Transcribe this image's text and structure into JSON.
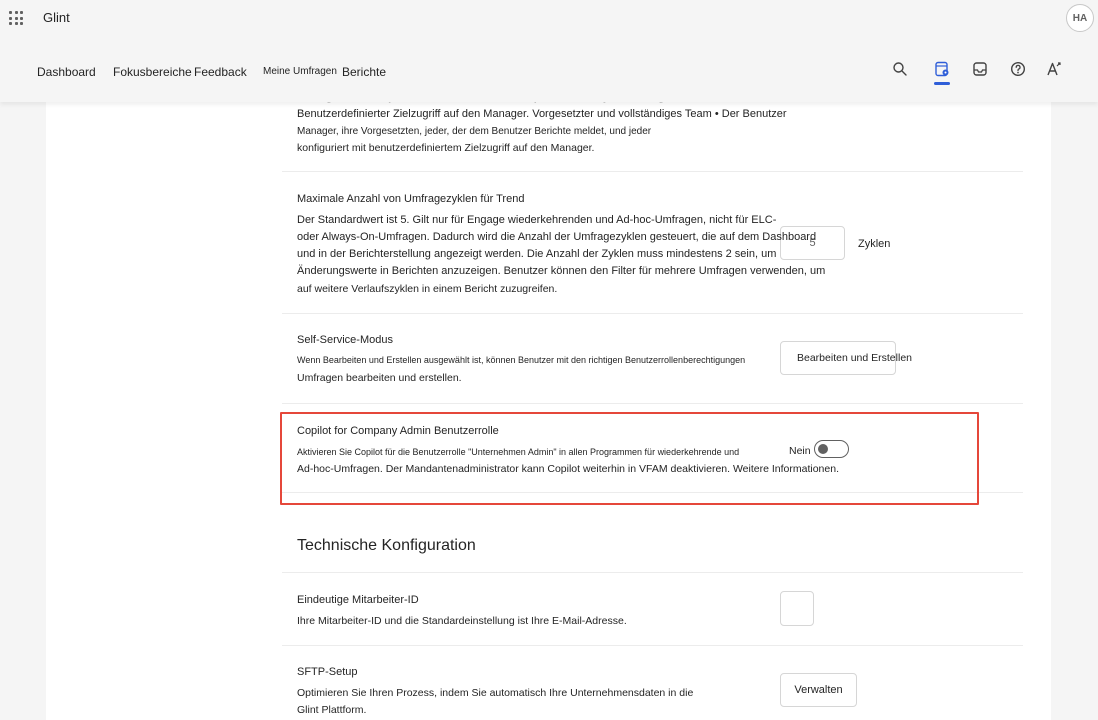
{
  "app": {
    "name": "Glint",
    "avatar_initials": "HA"
  },
  "nav": {
    "items": [
      "Dashboard",
      "Fokusbereiche",
      "Feedback",
      "Meine Umfragen",
      "Berichte"
    ],
    "icons": [
      "search-icon",
      "admin-settings-icon",
      "inbox-icon",
      "help-icon",
      "text-settings-icon"
    ],
    "accent_color": "#2f5ed8"
  },
  "sections": {
    "scope_partial": {
      "cut_line": "manager, their superiors*, the user's direct reports, and anyone configured with",
      "text": "Benutzerdefinierter Zielzugriff auf den Manager. Vorgesetzter und vollständiges Team • Der Benutzer Manager, ihre Vorgesetzten, jeder, der dem Benutzer Berichte meldet, und jeder konfiguriert mit benutzerdefiniertem Zielzugriff auf den Manager.",
      "lines": [
        "Benutzerdefinierter Zielzugriff auf den Manager. Vorgesetzter und vollständiges Team • Der Benutzer",
        "Manager, ihre Vorgesetzten, jeder, der dem Benutzer Berichte meldet, und jeder",
        "konfiguriert mit benutzerdefiniertem Zielzugriff auf den Manager."
      ]
    },
    "trend": {
      "title": "Maximale Anzahl von Umfragezyklen für Trend",
      "lines": [
        "Der Standardwert ist 5. Gilt nur für Engage wiederkehrenden und Ad-hoc-Umfragen, nicht für ELC-",
        "oder Always-On-Umfragen. Dadurch wird die Anzahl der Umfragezyklen gesteuert, die auf dem Dashboard",
        "und in der Berichterstellung angezeigt werden. Die Anzahl der Zyklen muss mindestens 2 sein, um",
        "Änderungswerte in Berichten anzuzeigen. Benutzer können den Filter für mehrere Umfragen verwenden, um",
        "auf weitere Verlaufszyklen in einem Bericht zuzugreifen."
      ],
      "input_value": "5",
      "unit": "Zyklen"
    },
    "self_service": {
      "title": "Self-Service-Modus",
      "lines": [
        "Wenn Bearbeiten und Erstellen ausgewählt ist, können Benutzer mit den richtigen Benutzerrollenberechtigungen",
        "Umfragen bearbeiten und erstellen."
      ],
      "button": "Bearbeiten und Erstellen"
    },
    "copilot": {
      "title": "Copilot for Company Admin Benutzerrolle",
      "lines": [
        "Aktivieren Sie Copilot für die Benutzerrolle \"Unternehmen Admin\" in allen Programmen für wiederkehrende und",
        "Ad-hoc-Umfragen. Der Mandantenadministrator kann Copilot weiterhin in VFAM deaktivieren. Weitere Informationen."
      ],
      "toggle_label": "Nein",
      "toggle_on": false,
      "highlight_color": "#e5473a"
    },
    "technical": {
      "heading": "Technische Konfiguration",
      "employee_id": {
        "title": "Eindeutige Mitarbeiter-ID",
        "text": "Ihre Mitarbeiter-ID und die Standardeinstellung ist Ihre E-Mail-Adresse.",
        "value": ""
      },
      "sftp": {
        "title": "SFTP-Setup",
        "lines": [
          "Optimieren Sie Ihren Prozess, indem Sie automatisch Ihre Unternehmensdaten in die",
          "Glint Plattform."
        ],
        "button": "Verwalten"
      }
    }
  }
}
